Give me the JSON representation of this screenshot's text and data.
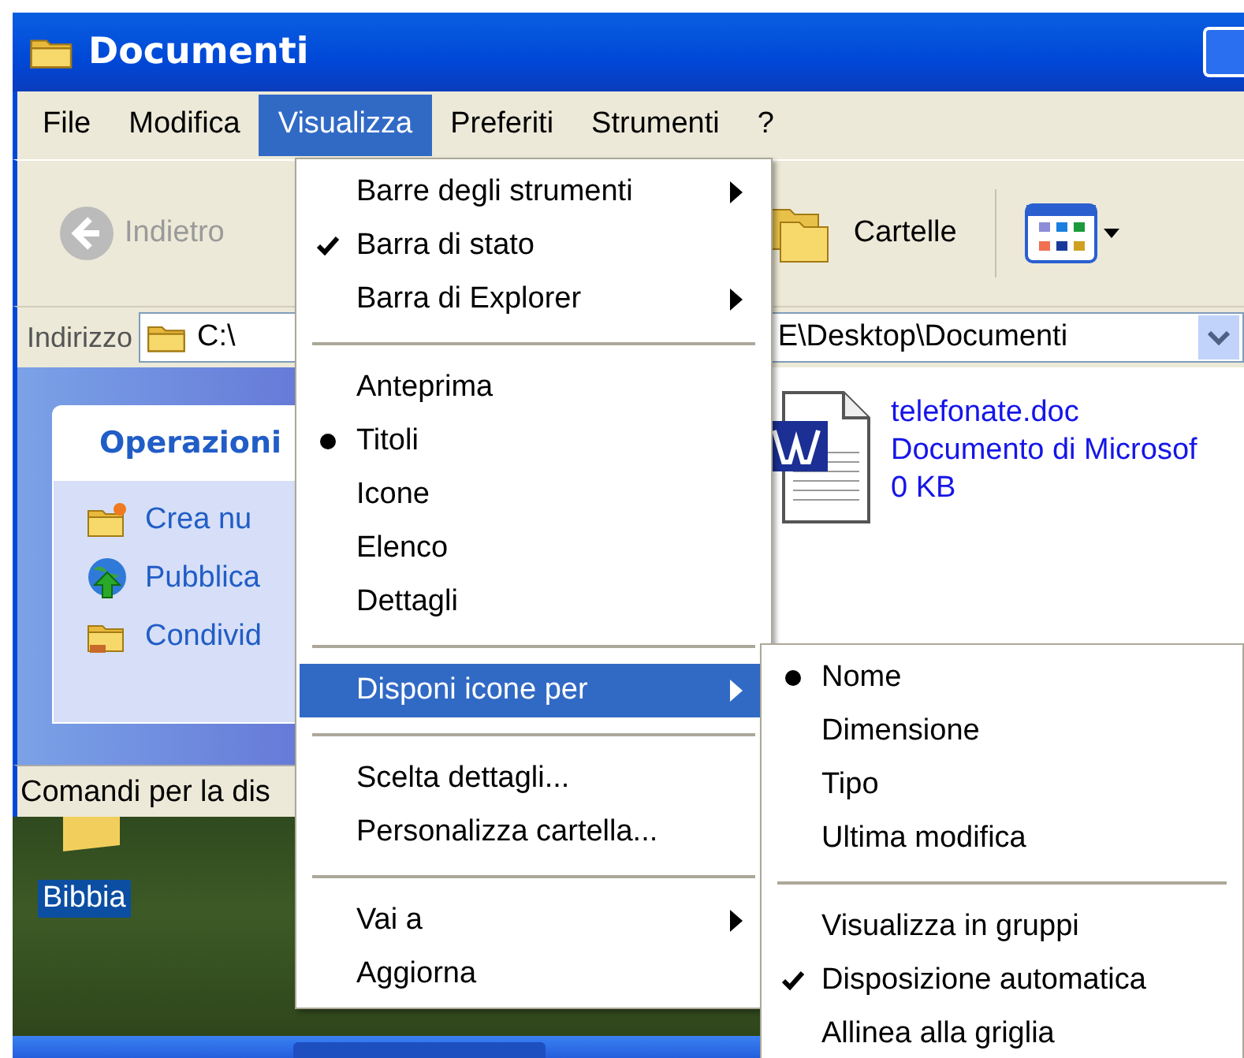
{
  "window": {
    "title": "Documenti"
  },
  "menubar": [
    {
      "label": "File",
      "selected": false
    },
    {
      "label": "Modifica",
      "selected": false
    },
    {
      "label": "Visualizza",
      "selected": true
    },
    {
      "label": "Preferiti",
      "selected": false
    },
    {
      "label": "Strumenti",
      "selected": false
    },
    {
      "label": "?",
      "selected": false
    }
  ],
  "toolbar": {
    "back": {
      "label": "Indietro",
      "disabled": true
    },
    "folders": {
      "label": "Cartelle"
    }
  },
  "address_bar": {
    "label": "Indirizzo",
    "value_start": "C:\\",
    "value_end": "E\\Desktop\\Documenti"
  },
  "task_panel": {
    "title": "Operazioni",
    "tasks": [
      {
        "kind": "new-folder",
        "label": "Crea nu"
      },
      {
        "kind": "publish",
        "label": "Pubblica"
      },
      {
        "kind": "share",
        "label": "Condivid"
      }
    ]
  },
  "files": [
    {
      "name": "telefonate.doc",
      "type": "Documento di Microsof",
      "size": "0 KB"
    }
  ],
  "status_bar": "Comandi per la dis",
  "desktop": {
    "icons": [
      {
        "label": "Bibbia",
        "selected": true
      }
    ]
  },
  "view_menu": {
    "items": [
      {
        "kind": "command",
        "label": "Barre degli strumenti",
        "submenu": true,
        "selected": false
      },
      {
        "kind": "check",
        "label": "Barra di stato",
        "checked": true,
        "submenu": false,
        "selected": false
      },
      {
        "kind": "command",
        "label": "Barra di Explorer",
        "submenu": true,
        "selected": false
      },
      {
        "kind": "separator"
      },
      {
        "kind": "radio",
        "label": "Anteprima",
        "checked": false,
        "submenu": false,
        "selected": false
      },
      {
        "kind": "radio",
        "label": "Titoli",
        "checked": true,
        "submenu": false,
        "selected": false
      },
      {
        "kind": "radio",
        "label": "Icone",
        "checked": false,
        "submenu": false,
        "selected": false
      },
      {
        "kind": "radio",
        "label": "Elenco",
        "checked": false,
        "submenu": false,
        "selected": false
      },
      {
        "kind": "radio",
        "label": "Dettagli",
        "checked": false,
        "submenu": false,
        "selected": false
      },
      {
        "kind": "separator"
      },
      {
        "kind": "command",
        "label": "Disponi icone per",
        "submenu": true,
        "selected": true
      },
      {
        "kind": "separator"
      },
      {
        "kind": "command",
        "label": "Scelta dettagli...",
        "submenu": false,
        "selected": false
      },
      {
        "kind": "command",
        "label": "Personalizza cartella...",
        "submenu": false,
        "selected": false
      },
      {
        "kind": "separator"
      },
      {
        "kind": "command",
        "label": "Vai a",
        "submenu": true,
        "selected": false
      },
      {
        "kind": "command",
        "label": "Aggiorna",
        "submenu": false,
        "selected": false
      }
    ]
  },
  "arrange_submenu": {
    "items": [
      {
        "kind": "radio",
        "label": "Nome",
        "checked": true,
        "submenu": false,
        "selected": false
      },
      {
        "kind": "radio",
        "label": "Dimensione",
        "checked": false,
        "submenu": false,
        "selected": false
      },
      {
        "kind": "radio",
        "label": "Tipo",
        "checked": false,
        "submenu": false,
        "selected": false
      },
      {
        "kind": "radio",
        "label": "Ultima modifica",
        "checked": false,
        "submenu": false,
        "selected": false
      },
      {
        "kind": "separator"
      },
      {
        "kind": "check",
        "label": "Visualizza in gruppi",
        "checked": false,
        "submenu": false,
        "selected": false
      },
      {
        "kind": "check",
        "label": "Disposizione automatica",
        "checked": true,
        "submenu": false,
        "selected": false
      },
      {
        "kind": "check",
        "label": "Allinea alla griglia",
        "checked": false,
        "submenu": false,
        "selected": false
      }
    ]
  }
}
